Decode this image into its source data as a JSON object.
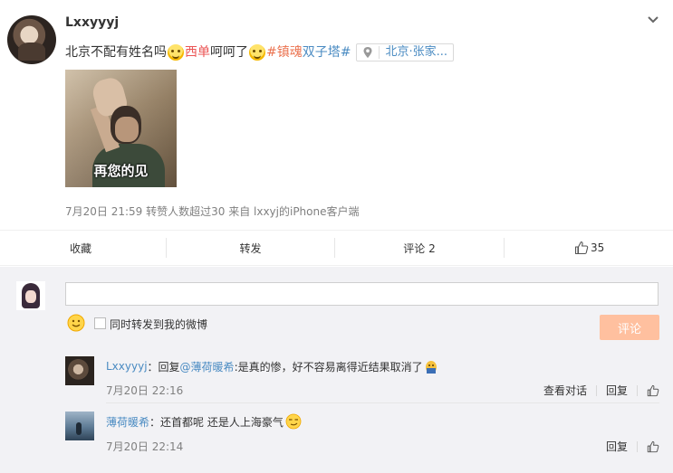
{
  "post": {
    "username": "Lxxyyyj",
    "text_1": "北京不配有姓名吗",
    "text_red": "西单",
    "text_2": "呵呵了",
    "hashtag_1": "#镇魂",
    "hashtag_2": "双子塔#",
    "location": "北京·张家...",
    "photo_caption": "再您的见",
    "meta": "7月20日 21:59 转赞人数超过30 来自 lxxyj的iPhone客户端"
  },
  "actions": {
    "favorite": "收藏",
    "forward": "转发",
    "comment": "评论 2",
    "like": "35"
  },
  "composer": {
    "input_value": "",
    "also_forward_label": "同时转发到我的微博",
    "submit_label": "评论"
  },
  "comments": [
    {
      "user": "Lxxyyyj",
      "reply_prefix": "：回复",
      "mention": "@薄荷暖希",
      "text": ":是真的惨，好不容易离得近结果取消了",
      "time": "7月20日 22:16",
      "view_thread": "查看对话",
      "reply": "回复"
    },
    {
      "user": "薄荷暖希",
      "text": "：还首都呢 还是人上海豪气",
      "time": "7月20日 22:14",
      "reply": "回复"
    }
  ],
  "colors": {
    "link_blue": "#4a8bc2",
    "hashtag_orange": "#eb7350",
    "submit_disabled": "#ffc09f"
  }
}
